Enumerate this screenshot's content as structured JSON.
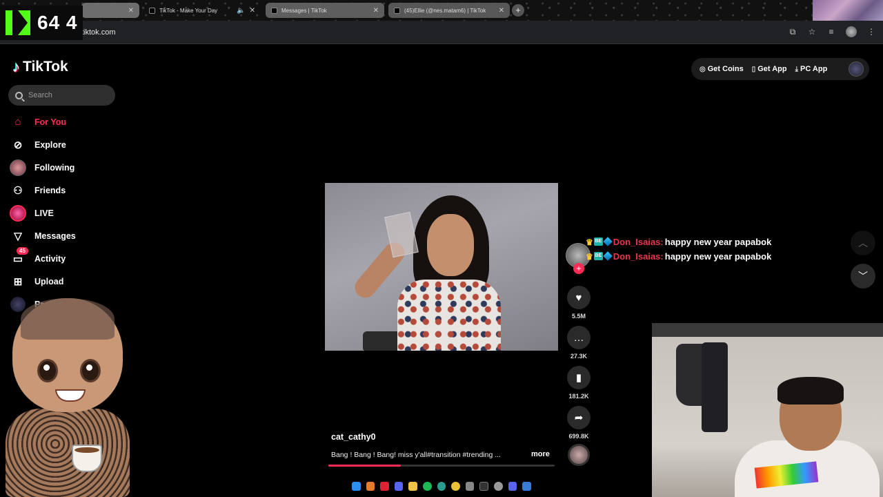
{
  "browser": {
    "tabs": [
      {
        "title": ""
      },
      {
        "title": "TikTok - Make Your Day"
      },
      {
        "title": "Messages | TikTok"
      },
      {
        "title": "(45)Ellie (@nes.matam6) | TikTok"
      }
    ],
    "url": "tiktok.com"
  },
  "kick_overlay": {
    "count": "64 4"
  },
  "tiktok": {
    "logo": "TikTok",
    "search": {
      "placeholder": "Search"
    },
    "nav": [
      {
        "label": "For You",
        "icon": "home-icon",
        "active": true
      },
      {
        "label": "Explore",
        "icon": "compass-icon"
      },
      {
        "label": "Following",
        "icon": "following-avatar-icon"
      },
      {
        "label": "Friends",
        "icon": "friends-icon"
      },
      {
        "label": "LIVE",
        "icon": "live-icon"
      },
      {
        "label": "Messages",
        "icon": "messages-icon"
      },
      {
        "label": "Activity",
        "icon": "activity-icon",
        "badge": "45"
      },
      {
        "label": "Upload",
        "icon": "upload-icon"
      },
      {
        "label": "Profile",
        "icon": "profile-icon"
      }
    ],
    "header_buttons": {
      "get_coins": "Get Coins",
      "get_app": "Get App",
      "pc_app": "PC App"
    },
    "video": {
      "username": "cat_cathy0",
      "caption": "Bang ! Bang ! Bang! miss y'all#transition #trending ...",
      "more": "more",
      "progress": 0.32
    },
    "actions": {
      "likes": "5.5M",
      "comments": "27.3K",
      "saves": "181.2K",
      "shares": "699.8K"
    }
  },
  "chat": [
    {
      "user": "Don_Isaias:",
      "message": "happy new year papabok",
      "badge_text": "BE"
    },
    {
      "user": "Don_Isaias:",
      "message": "happy new year papabok",
      "badge_text": "BE"
    }
  ],
  "colors": {
    "accent": "#fe2c55",
    "kick_green": "#53fc18",
    "chat_name": "#e9374d"
  }
}
